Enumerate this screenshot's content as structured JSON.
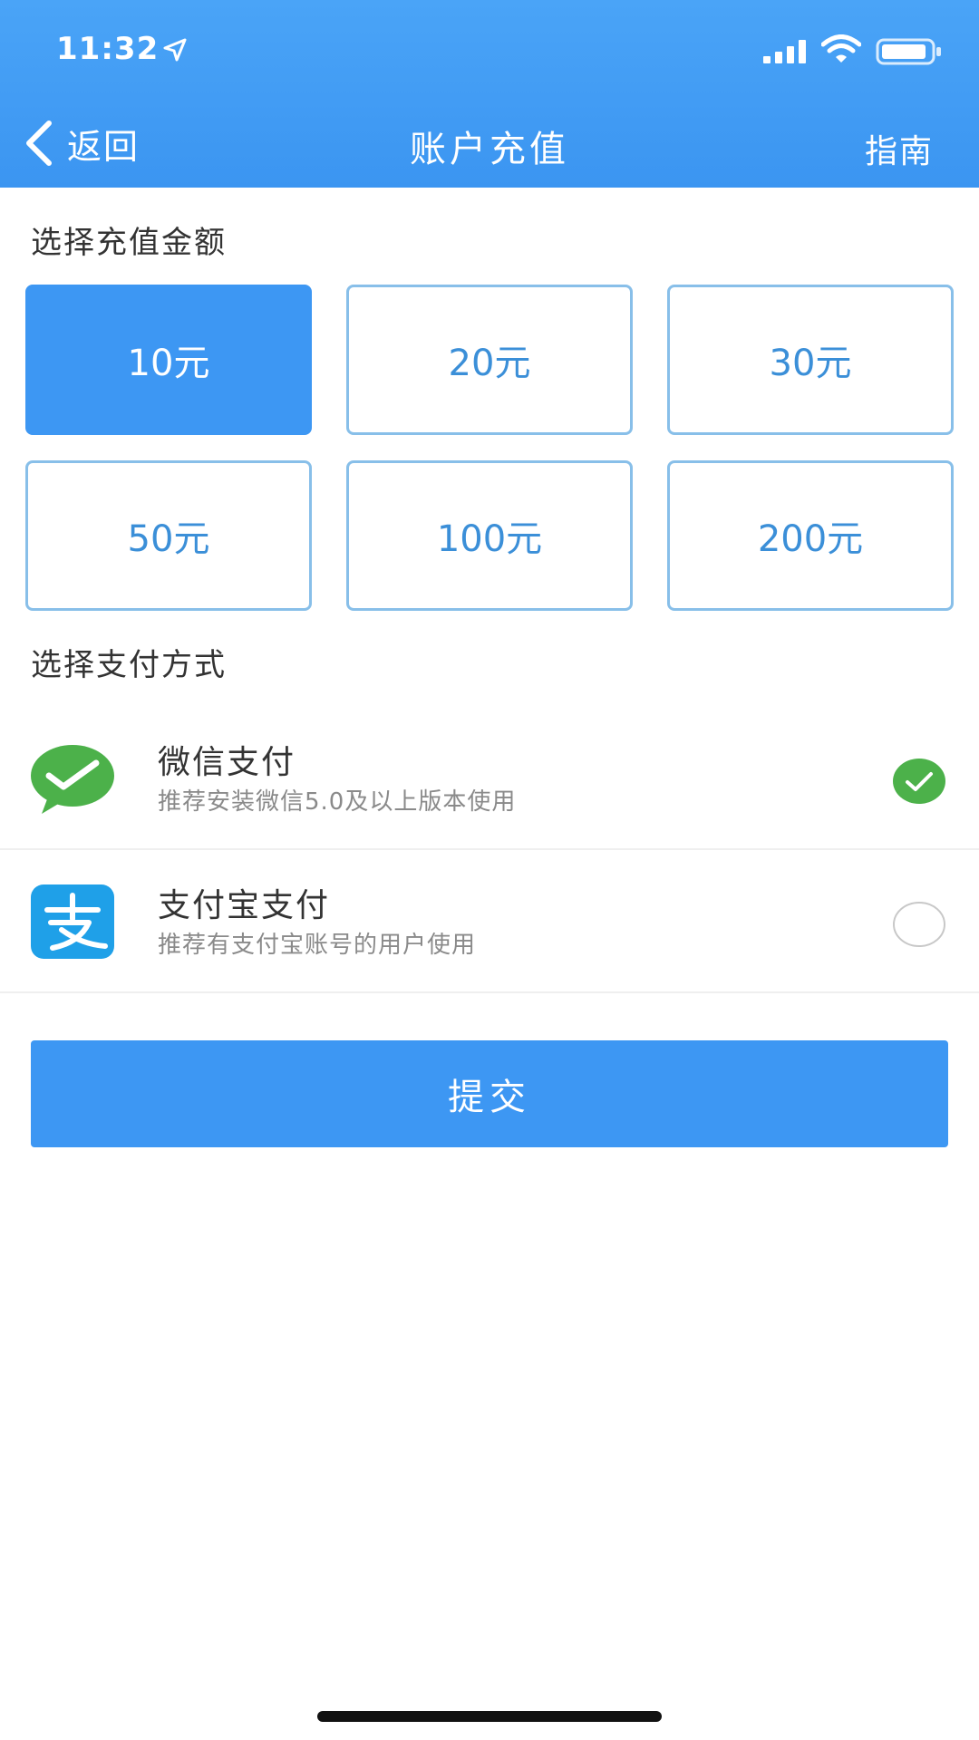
{
  "status_bar": {
    "time": "11:32",
    "icons": [
      "location-arrow-icon",
      "signal-icon",
      "wifi-icon",
      "battery-icon"
    ]
  },
  "nav": {
    "back_label": "返回",
    "title": "账户充值",
    "guide_label": "指南"
  },
  "amount_section": {
    "title": "选择充值金额",
    "options": [
      {
        "label": "10元",
        "selected": true
      },
      {
        "label": "20元",
        "selected": false
      },
      {
        "label": "30元",
        "selected": false
      },
      {
        "label": "50元",
        "selected": false
      },
      {
        "label": "100元",
        "selected": false
      },
      {
        "label": "200元",
        "selected": false
      }
    ]
  },
  "payment_section": {
    "title": "选择支付方式",
    "methods": [
      {
        "name": "微信支付",
        "desc": "推荐安装微信5.0及以上版本使用",
        "icon": "wechat-pay-icon",
        "selected": true
      },
      {
        "name": "支付宝支付",
        "desc": "推荐有支付宝账号的用户使用",
        "icon": "alipay-icon",
        "selected": false
      }
    ]
  },
  "submit_label": "提交",
  "colors": {
    "primary": "#3d97f3",
    "border": "#88bfe9",
    "wechat_green": "#4cb14a",
    "alipay_blue": "#1fa0e8"
  }
}
